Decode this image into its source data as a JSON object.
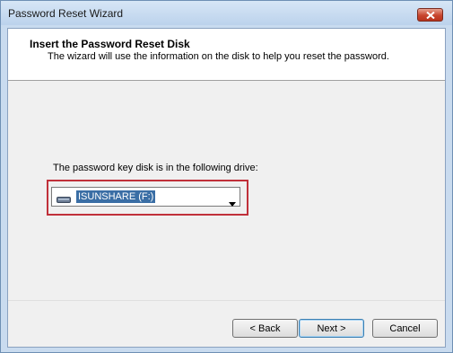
{
  "window": {
    "title": "Password Reset Wizard"
  },
  "header": {
    "title": "Insert the Password Reset Disk",
    "subtitle": "The wizard will use the information on the disk to help you reset the password."
  },
  "content": {
    "drive_label": "The password key disk is in the following drive:",
    "drive_select": {
      "value": "ISUNSHARE (F:)",
      "icon": "usb-drive-icon"
    }
  },
  "buttons": {
    "back": "< Back",
    "next": "Next >",
    "cancel": "Cancel"
  },
  "colors": {
    "highlight": "#c0303a",
    "selection": "#3a6ea5"
  }
}
